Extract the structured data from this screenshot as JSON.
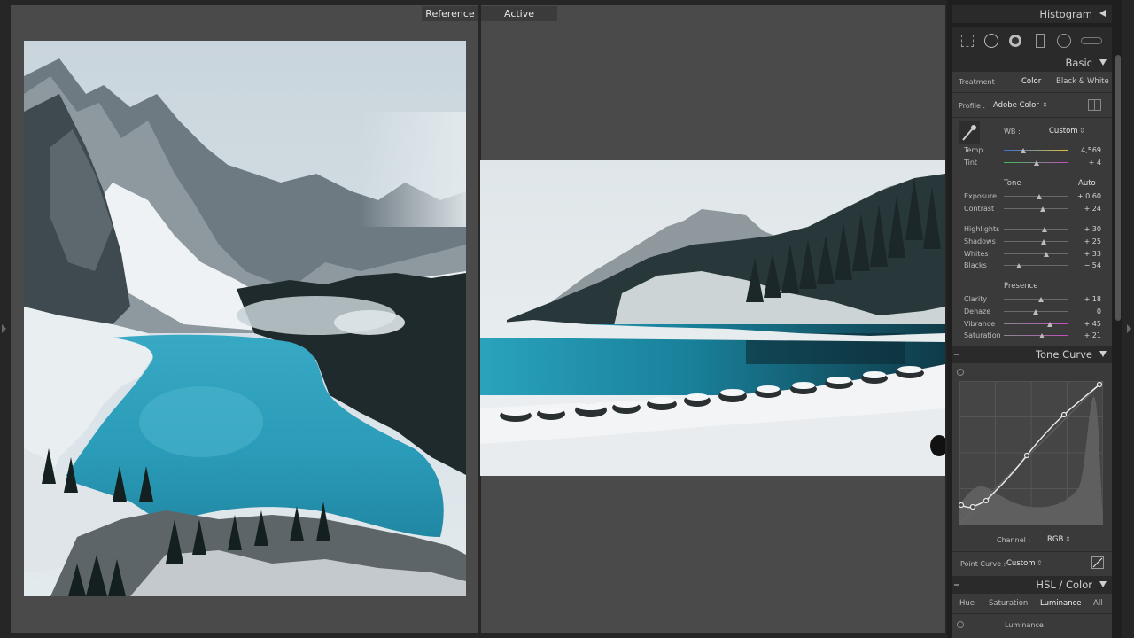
{
  "view": {
    "reference_label": "Reference",
    "active_label": "Active"
  },
  "panel": {
    "histogram": {
      "title": "Histogram"
    },
    "tools": [
      "crop-overlay-icon",
      "spot-removal-icon",
      "red-eye-icon",
      "graduated-filter-icon",
      "radial-filter-icon",
      "adjustment-brush-icon"
    ],
    "basic": {
      "title": "Basic",
      "treatment_label": "Treatment :",
      "treatment_color": "Color",
      "treatment_bw": "Black & White",
      "profile_label": "Profile :",
      "profile_value": "Adobe Color",
      "wb_label": "WB :",
      "wb_value": "Custom",
      "temp_label": "Temp",
      "temp_value": "4,569",
      "temp_pos": 0.3,
      "tint_label": "Tint",
      "tint_value": "+ 4",
      "tint_pos": 0.52,
      "tone_label": "Tone",
      "auto_label": "Auto",
      "exposure_label": "Exposure",
      "exposure_value": "+ 0.60",
      "exposure_pos": 0.56,
      "contrast_label": "Contrast",
      "contrast_value": "+ 24",
      "contrast_pos": 0.61,
      "highlights_label": "Highlights",
      "highlights_value": "+ 30",
      "highlights_pos": 0.64,
      "shadows_label": "Shadows",
      "shadows_value": "+ 25",
      "shadows_pos": 0.62,
      "whites_label": "Whites",
      "whites_value": "+ 33",
      "whites_pos": 0.66,
      "blacks_label": "Blacks",
      "blacks_value": "− 54",
      "blacks_pos": 0.23,
      "presence_label": "Presence",
      "clarity_label": "Clarity",
      "clarity_value": "+ 18",
      "clarity_pos": 0.59,
      "dehaze_label": "Dehaze",
      "dehaze_value": "0",
      "dehaze_pos": 0.5,
      "vibrance_label": "Vibrance",
      "vibrance_value": "+ 45",
      "vibrance_pos": 0.72,
      "saturation_label": "Saturation",
      "saturation_value": "+ 21",
      "saturation_pos": 0.6
    },
    "tone_curve": {
      "title": "Tone Curve",
      "channel_label": "Channel :",
      "channel_value": "RGB",
      "point_curve_label": "Point Curve :",
      "point_curve_value": "Custom"
    },
    "hsl": {
      "title": "HSL / Color",
      "tab_hue": "Hue",
      "tab_saturation": "Saturation",
      "tab_luminance": "Luminance",
      "tab_all": "All",
      "section_label": "Luminance"
    }
  },
  "colors": {
    "panel_bg": "#3a3a3a",
    "panel_header": "#2a2a2a",
    "work_bg": "#4a4a4a",
    "app_bg": "#262626",
    "lake_turquoise": "#2aa3bd"
  }
}
